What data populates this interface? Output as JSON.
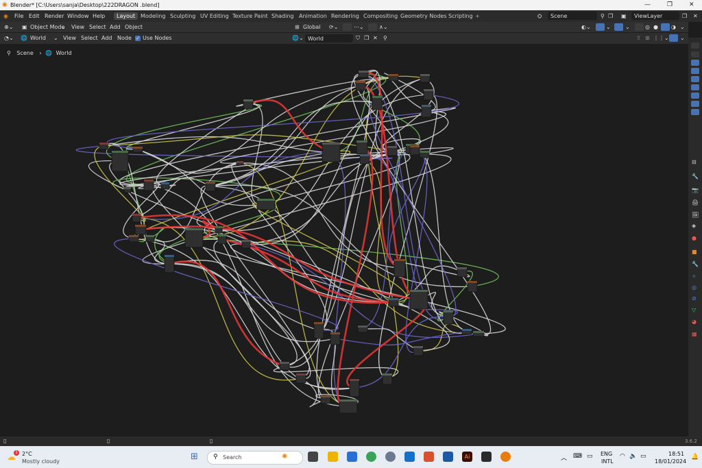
{
  "window": {
    "title": "Blender* [C:\\Users\\sanja\\Desktop\\222DRAGON .blend]"
  },
  "menu": [
    "File",
    "Edit",
    "Render",
    "Window",
    "Help"
  ],
  "workspaces": [
    {
      "label": "Layout",
      "active": true
    },
    {
      "label": "Modeling",
      "active": false
    },
    {
      "label": "Sculpting",
      "active": false
    },
    {
      "label": "UV Editing",
      "active": false
    },
    {
      "label": "Texture Paint",
      "active": false
    },
    {
      "label": "Shading",
      "active": false
    },
    {
      "label": "Animation",
      "active": false
    },
    {
      "label": "Rendering",
      "active": false
    },
    {
      "label": "Compositing",
      "active": false
    },
    {
      "label": "Geometry Nodes",
      "active": false
    },
    {
      "label": "Scripting",
      "active": false
    }
  ],
  "scene_field": "Scene",
  "viewlayer_field": "ViewLayer",
  "viewport_header": {
    "mode": "Object Mode",
    "menus": [
      "View",
      "Select",
      "Add",
      "Object"
    ],
    "transform_orientation": "Global"
  },
  "node_header": {
    "shader_type": "World",
    "menus": [
      "View",
      "Select",
      "Add",
      "Node"
    ],
    "use_nodes_label": "Use Nodes",
    "world_field": "World"
  },
  "breadcrumb": [
    "Scene",
    "World"
  ],
  "version": "3.6.2",
  "taskbar": {
    "weather_temp": "2°C",
    "weather_desc": "Mostly cloudy",
    "search_placeholder": "Search",
    "lang1": "ENG",
    "lang2": "INTL",
    "time": "18:51",
    "date": "18/01/2024",
    "notif": "1"
  },
  "colors": {
    "accent": "#4772b3",
    "active_tab": "#484848",
    "wire_default": "#d6d6d6",
    "wire_red": "#e23636",
    "wire_yellow": "#c9c24a",
    "wire_purple": "#6a66c9",
    "wire_green": "#6fbf5a"
  }
}
